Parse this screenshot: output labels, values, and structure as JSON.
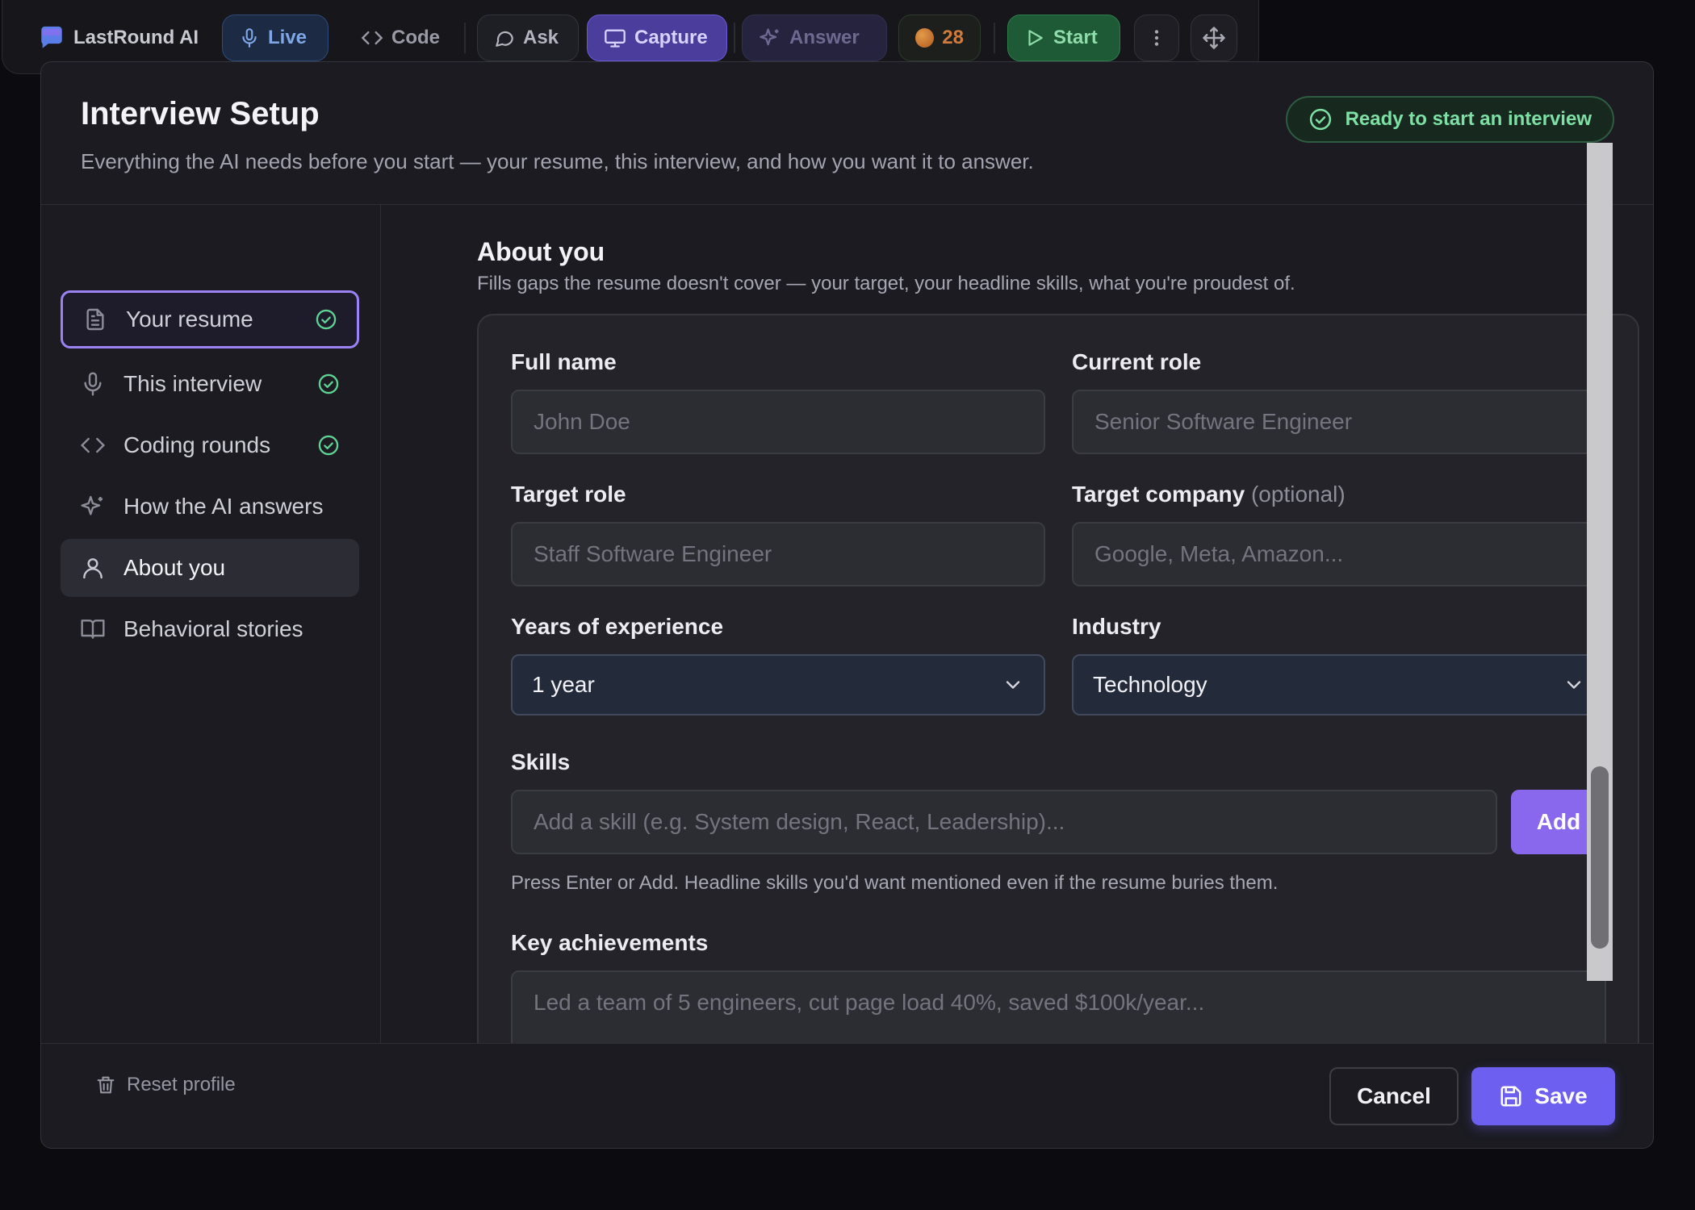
{
  "toolbar": {
    "brand": "LastRound AI",
    "live": "Live",
    "code": "Code",
    "ask": "Ask",
    "capture": "Capture",
    "answer": "Answer",
    "count": "28",
    "start": "Start"
  },
  "header": {
    "title": "Interview Setup",
    "subtitle": "Everything the AI needs before you start — your resume, this interview, and how you want it to answer.",
    "status": "Ready to start an interview"
  },
  "sidebar": {
    "items": [
      {
        "label": "Your resume",
        "icon": "document-icon",
        "done": true
      },
      {
        "label": "This interview",
        "icon": "microphone-icon",
        "done": true
      },
      {
        "label": "Coding rounds",
        "icon": "code-icon",
        "done": true
      },
      {
        "label": "How the AI answers",
        "icon": "sparkle-icon",
        "done": false
      },
      {
        "label": "About you",
        "icon": "user-icon",
        "done": false
      },
      {
        "label": "Behavioral stories",
        "icon": "book-icon",
        "done": false
      }
    ]
  },
  "section": {
    "title": "About you",
    "subtitle": "Fills gaps the resume doesn't cover — your target, your headline skills, what you're proudest of."
  },
  "form": {
    "full_name": {
      "label": "Full name",
      "placeholder": "John Doe"
    },
    "current_role": {
      "label": "Current role",
      "placeholder": "Senior Software Engineer"
    },
    "target_role": {
      "label": "Target role",
      "placeholder": "Staff Software Engineer"
    },
    "target_company": {
      "label": "Target company",
      "optional": "(optional)",
      "placeholder": "Google, Meta, Amazon..."
    },
    "years": {
      "label": "Years of experience",
      "value": "1 year"
    },
    "industry": {
      "label": "Industry",
      "value": "Technology"
    },
    "skills": {
      "label": "Skills",
      "placeholder": "Add a skill (e.g. System design, React, Leadership)...",
      "add": "Add",
      "hint": "Press Enter or Add. Headline skills you'd want mentioned even if the resume buries them."
    },
    "achievements": {
      "label": "Key achievements",
      "placeholder": "Led a team of 5 engineers, cut page load 40%, saved $100k/year..."
    }
  },
  "footer": {
    "reset": "Reset profile",
    "cancel": "Cancel",
    "save": "Save"
  },
  "colors": {
    "accent": "#8a68ee",
    "save": "#6d5ff0",
    "success": "#7ee0a5",
    "background": "#1b1b21"
  }
}
